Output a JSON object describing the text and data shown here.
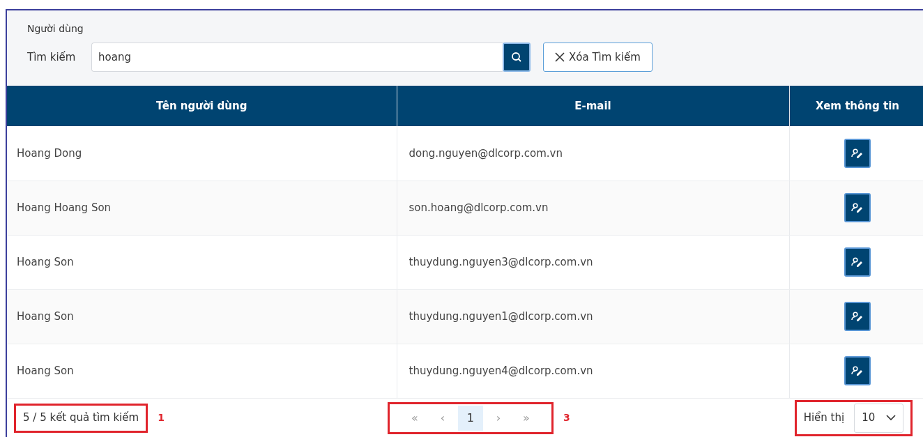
{
  "panel": {
    "title": "Người dùng"
  },
  "search": {
    "label": "Tìm kiếm",
    "value": "hoang",
    "clear_label": "Xóa Tìm kiếm"
  },
  "table": {
    "columns": [
      "Tên người dùng",
      "E-mail",
      "Xem thông tin"
    ],
    "rows": [
      {
        "name": "Hoang Dong",
        "email": "dong.nguyen@dlcorp.com.vn"
      },
      {
        "name": "Hoang Hoang Son",
        "email": "son.hoang@dlcorp.com.vn"
      },
      {
        "name": "Hoang Son",
        "email": "thuydung.nguyen3@dlcorp.com.vn"
      },
      {
        "name": "Hoang Son",
        "email": "thuydung.nguyen1@dlcorp.com.vn"
      },
      {
        "name": "Hoang Son",
        "email": "thuydung.nguyen4@dlcorp.com.vn"
      }
    ]
  },
  "footer": {
    "result_count": "5 / 5 kết quả tìm kiếm",
    "annotation_1": "1",
    "pagination": [
      {
        "label": "«",
        "selected": false
      },
      {
        "label": "‹",
        "selected": false
      },
      {
        "label": "1",
        "selected": true
      },
      {
        "label": "›",
        "selected": false
      },
      {
        "label": "»",
        "selected": false
      }
    ],
    "annotation_3": "3",
    "page_size_label": "Hiển thị",
    "page_size": "10"
  }
}
